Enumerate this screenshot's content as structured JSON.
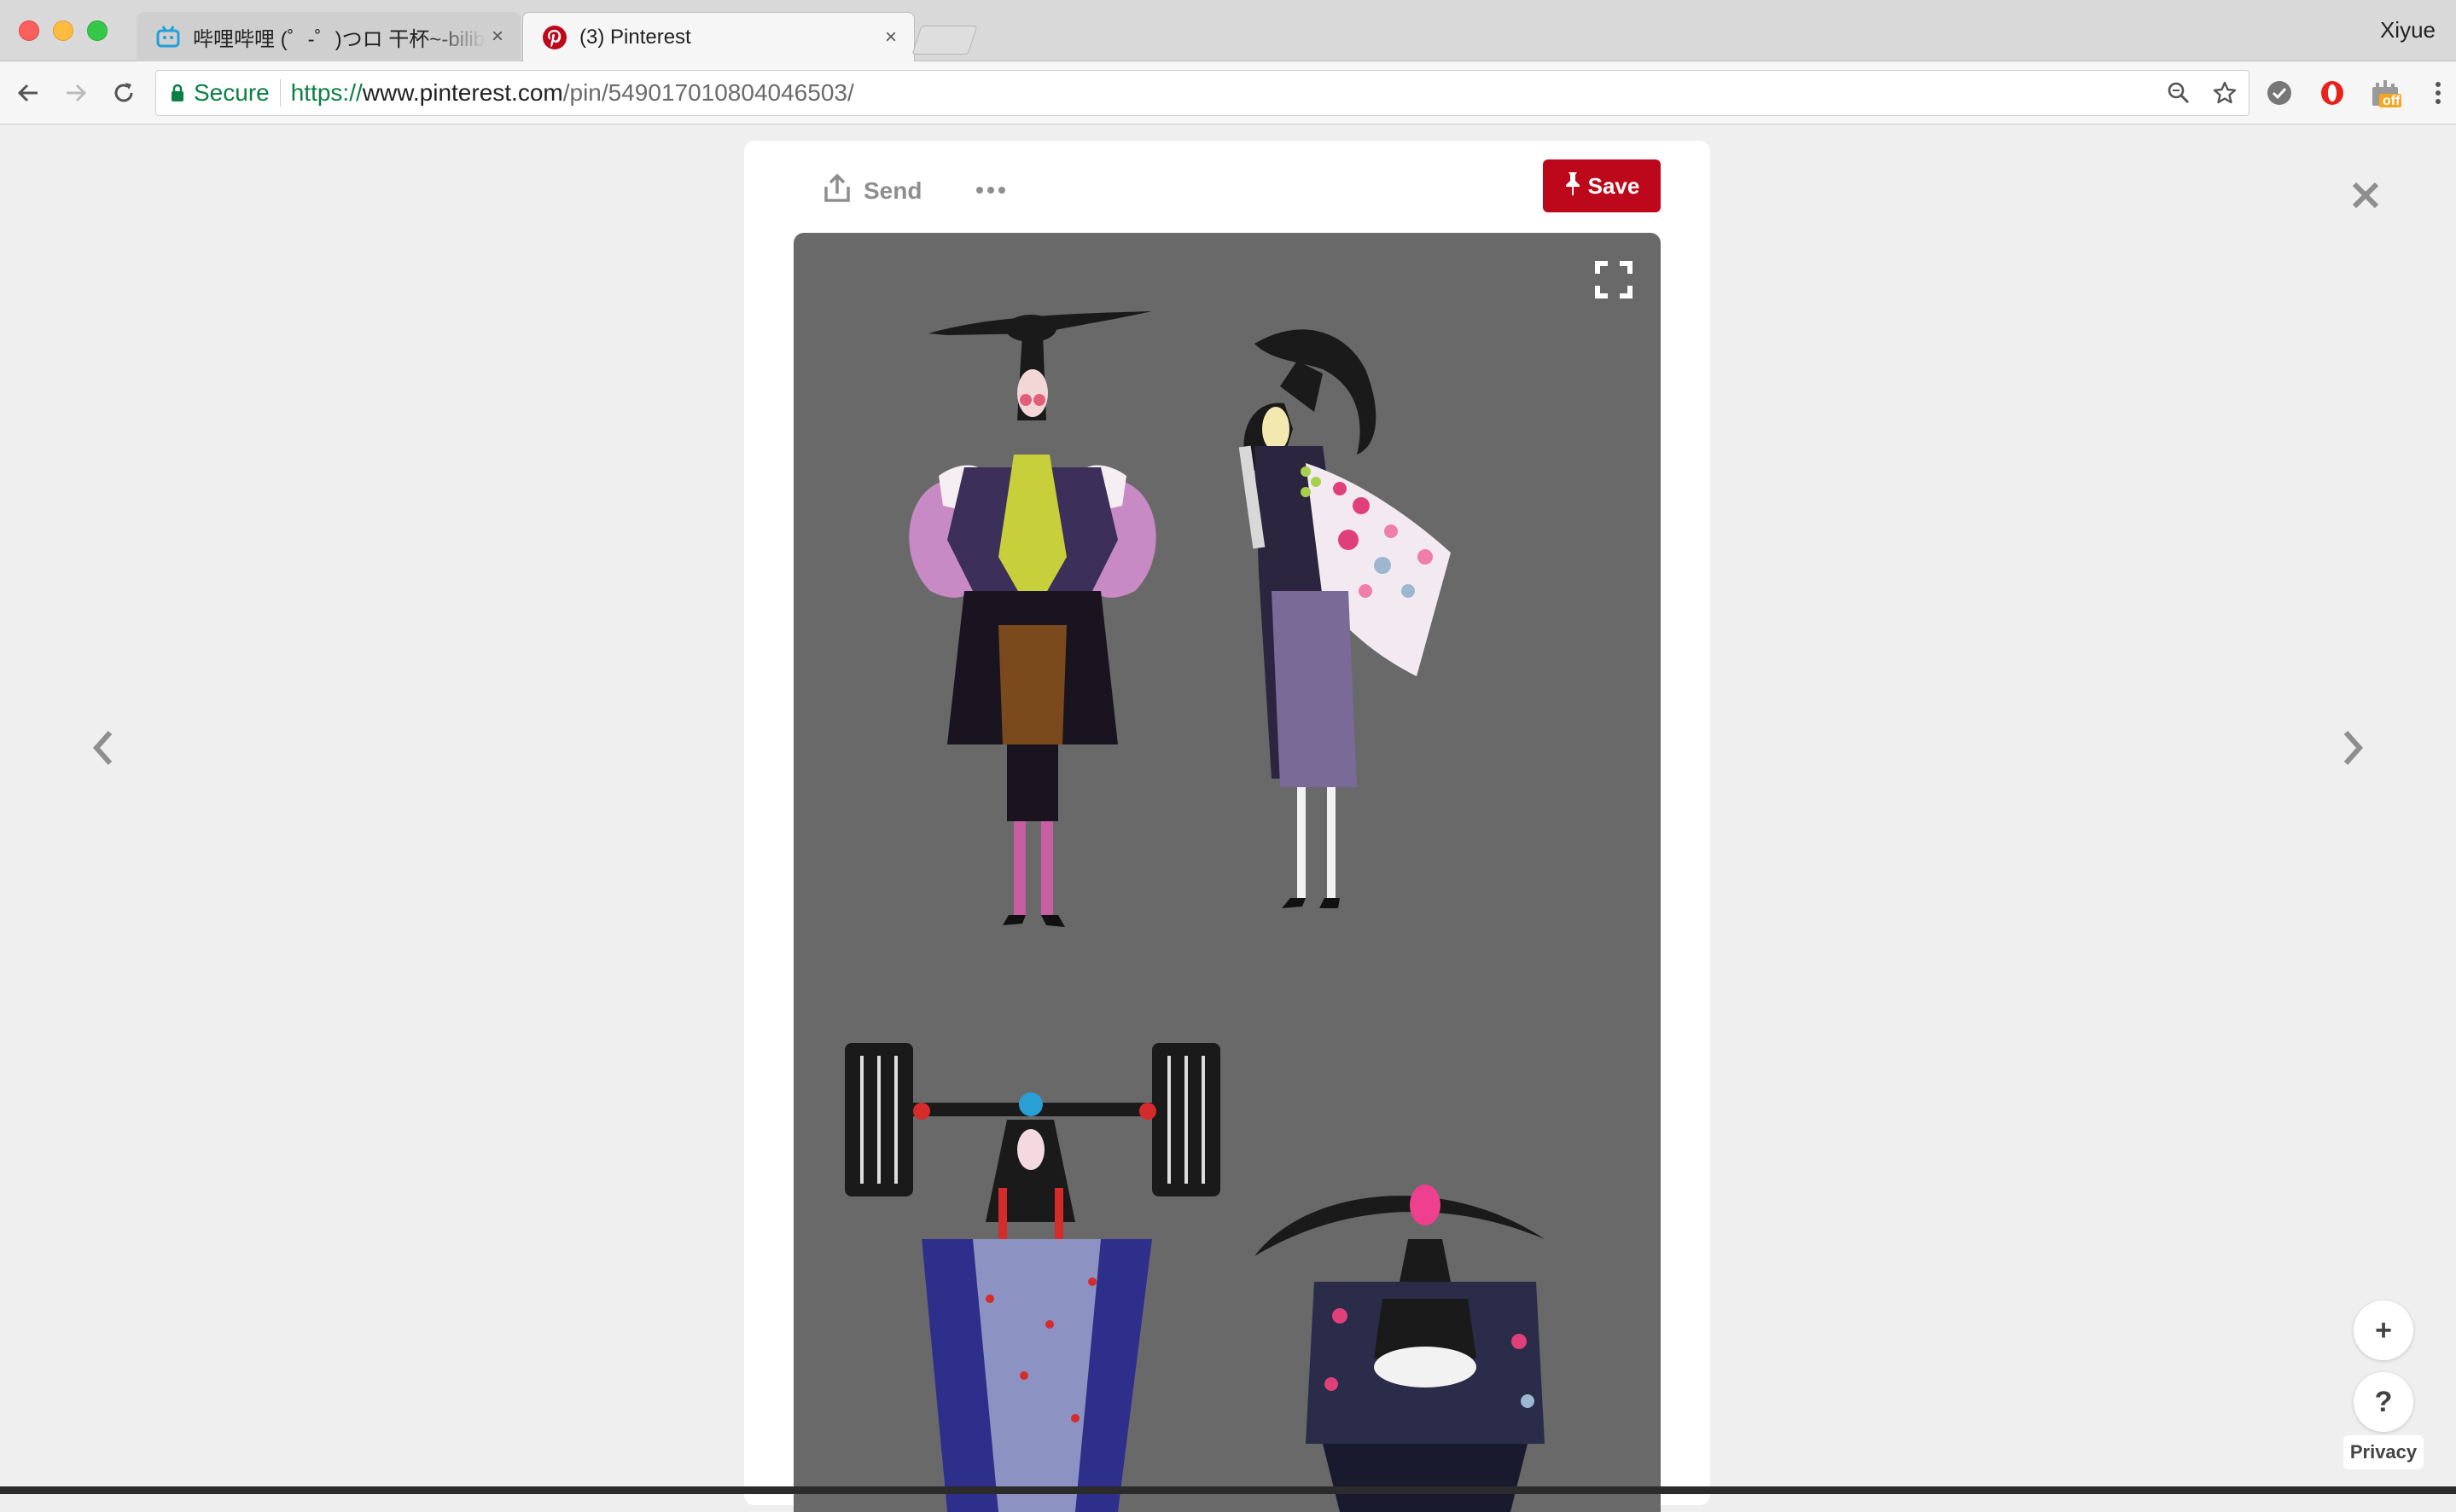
{
  "window": {
    "profile_name": "Xiyue"
  },
  "tabs": [
    {
      "title": "哔哩哔哩 (゜-゜)つロ 干杯~-bilibili",
      "close": "×",
      "favicon": "bilibili-icon",
      "active": false
    },
    {
      "title": "(3) Pinterest",
      "close": "×",
      "favicon": "pinterest-icon",
      "active": true
    }
  ],
  "toolbar": {
    "secure_label": "Secure",
    "url_scheme": "https://",
    "url_host": "www.pinterest.com",
    "url_path": "/pin/549017010804046503/",
    "icons": [
      "back-icon",
      "forward-icon",
      "reload-icon",
      "lock-icon",
      "zoom-icon",
      "star-icon"
    ],
    "extensions": [
      "shield-extension-icon",
      "opera-extension-icon",
      "off-extension-icon",
      "menu-icon"
    ],
    "off_badge": "off"
  },
  "pin": {
    "send_label": "Send",
    "save_label": "Save",
    "brand_color": "#bd081c",
    "image_background": "#696969"
  },
  "overlay": {
    "add_button": "+",
    "help_button": "?",
    "privacy_label": "Privacy"
  }
}
